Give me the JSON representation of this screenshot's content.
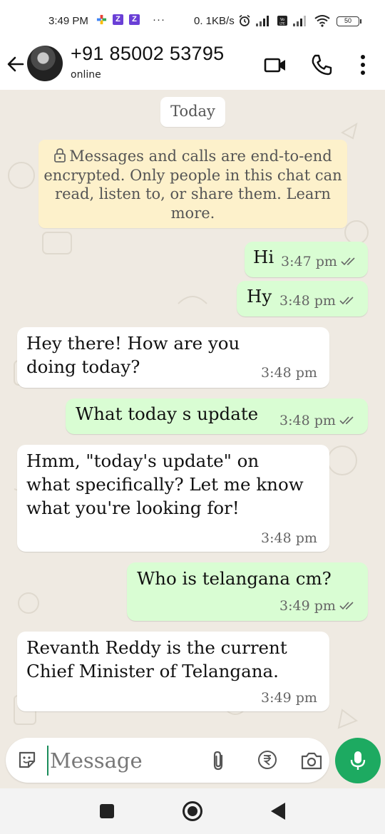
{
  "status_bar": {
    "time": "3:49 PM",
    "more": "···",
    "net_speed": "0. 1KB/s",
    "battery": "50"
  },
  "header": {
    "contact_name": "+91 85002 53795",
    "contact_status": "online",
    "icons": [
      "back-arrow-icon",
      "video-call-icon",
      "voice-call-icon",
      "more-options-icon"
    ]
  },
  "chat": {
    "date_label": "Today",
    "encryption_notice": "Messages and calls are end-to-end encrypted.  Only people in this chat can read,  listen to,  or share them. Learn more.",
    "messages": [
      {
        "direction": "out",
        "text": "Hi",
        "time": "3:47 pm",
        "read": true
      },
      {
        "direction": "out",
        "text": "Hy",
        "time": "3:48 pm",
        "read": true
      },
      {
        "direction": "in",
        "text": "Hey there!  How are you doing today?",
        "time": "3:48 pm"
      },
      {
        "direction": "out",
        "text": "What today s update",
        "time": "3:48 pm",
        "read": true
      },
      {
        "direction": "in",
        "text": "Hmm,  \"today's update\" on what specifically?  Let me know what you're looking for!",
        "time": "3:48 pm"
      },
      {
        "direction": "out",
        "text": "Who is telangana cm?",
        "time": "3:49 pm",
        "read": true
      },
      {
        "direction": "in",
        "text": "Revanth Reddy is the current Chief Minister of Telangana.",
        "time": "3:49 pm"
      }
    ]
  },
  "composer": {
    "placeholder": "Message",
    "icons": [
      "emoji-icon",
      "attach-icon",
      "rupee-payment-icon",
      "camera-icon",
      "mic-icon"
    ]
  },
  "colors": {
    "chat_bg": "#efeae2",
    "outgoing_bubble": "#d9fdd3",
    "incoming_bubble": "#ffffff",
    "encryption_bg": "#fdf1cb",
    "mic_button": "#1daa61",
    "read_ticks": "#666666"
  }
}
